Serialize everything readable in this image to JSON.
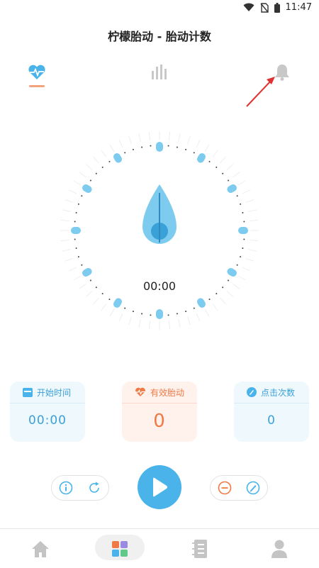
{
  "status_bar": {
    "time": "11:47"
  },
  "header": {
    "title": "柠檬胎动 - 胎动计数"
  },
  "top_nav": {
    "items": [
      "heartbeat-icon",
      "bar-chart-icon",
      "bell-icon"
    ],
    "active_index": 0
  },
  "timer": {
    "value": "00:00"
  },
  "cards": {
    "start_time": {
      "label": "开始时间",
      "value": "00:00"
    },
    "effective": {
      "label": "有效胎动",
      "value": "0"
    },
    "clicks": {
      "label": "点击次数",
      "value": "0"
    }
  },
  "controls": {
    "left": [
      "info-icon",
      "refresh-icon"
    ],
    "center": "play-icon",
    "right": [
      "minus-icon",
      "edit-icon"
    ]
  },
  "tab_bar": {
    "items": [
      "home-icon",
      "grid-icon",
      "notebook-icon",
      "profile-icon"
    ],
    "active_index": 1
  },
  "colors": {
    "accent_blue": "#49b3ea",
    "accent_orange": "#f07a45"
  }
}
